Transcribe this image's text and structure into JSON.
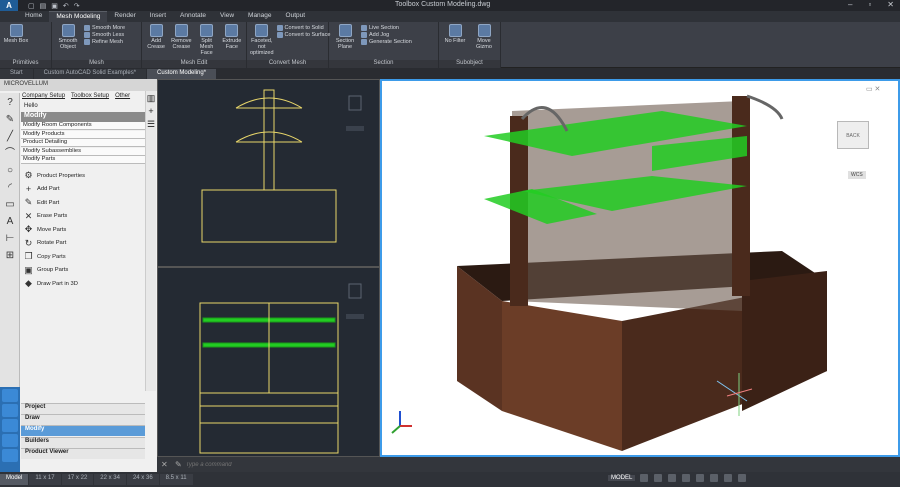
{
  "window": {
    "title": "Toolbox   Custom Modeling.dwg"
  },
  "ribbon_tabs": [
    "Home",
    "Mesh Modeling",
    "Render",
    "Insert",
    "Annotate",
    "View",
    "Manage",
    "Output"
  ],
  "active_ribbon_tab": "Mesh Modeling",
  "panels": [
    {
      "title": "Primitives",
      "buttons": [
        "Mesh Box"
      ]
    },
    {
      "title": "Mesh",
      "buttons": [
        "Smooth Object"
      ],
      "small": [
        "Smooth More",
        "Smooth Less",
        "Refine Mesh"
      ]
    },
    {
      "title": "Mesh Edit",
      "buttons": [
        "Add Crease",
        "Remove Crease",
        "Split Mesh Face",
        "Extrude Face"
      ]
    },
    {
      "title": "Convert Mesh",
      "small": [
        "Convert to Solid",
        "Convert to Surface"
      ],
      "buttons": [
        "Faceted, not optimized"
      ]
    },
    {
      "title": "Section",
      "buttons": [
        "Section Plane"
      ],
      "small": [
        "Live Section",
        "Add Jog",
        "Generate Section"
      ]
    },
    {
      "title": "Subobject",
      "buttons": [
        "No Filter",
        "Move Gizmo"
      ]
    }
  ],
  "doc_tabs": [
    "Start",
    "Custom AutoCAD Solid Examples*",
    "Custom Modeling*"
  ],
  "active_doc_tab": "Custom Modeling*",
  "palette": {
    "header": "MICROVELLUM",
    "tabs": [
      "Company Setup",
      "Toolbox Setup",
      "Other"
    ],
    "greeting": "Hello",
    "title": "Modify",
    "categories": [
      "Modify Room Components",
      "Modify Products",
      "Product Detailing",
      "Modify Subassemblies",
      "Modify Parts"
    ],
    "items": [
      "Product Properties",
      "Add Part",
      "Edit Part",
      "Erase Parts",
      "Move Parts",
      "Rotate Part",
      "Copy Parts",
      "Group Parts",
      "Draw Part in 3D"
    ],
    "sections": [
      "Project",
      "Draw",
      "Modify",
      "Builders",
      "Product Viewer"
    ],
    "active_section": "Modify"
  },
  "viewcube": {
    "label": "WCS",
    "face": "BACK"
  },
  "command": {
    "placeholder": "Type a command"
  },
  "layout_tabs": [
    "Model",
    "11 x 17",
    "17 x 22",
    "22 x 34",
    "24 x 36",
    "8.5 x 11"
  ],
  "active_layout": "Model",
  "status": {
    "mode": "MODEL"
  },
  "colors": {
    "accent": "#3d9be9",
    "highlight": "#22cc22",
    "wood": "#4a2a1c"
  }
}
